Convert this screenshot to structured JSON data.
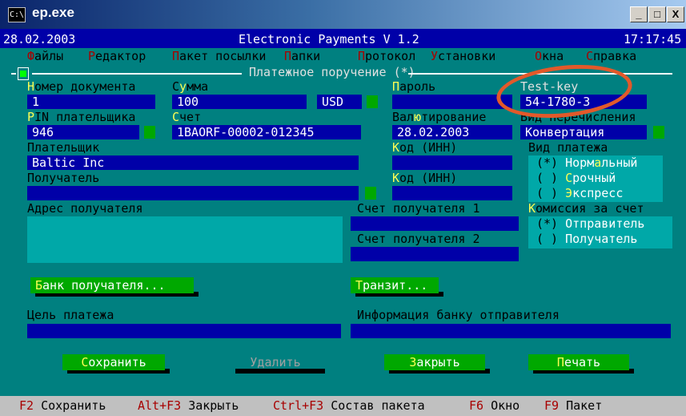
{
  "window": {
    "title": "ep.exe",
    "icon_text": "C:\\",
    "buttons": {
      "minimize": "_",
      "maximize": "□",
      "close": "X"
    }
  },
  "status": {
    "date": "28.02.2003",
    "app_title": "Electronic Payments V 1.2",
    "time": "17:17:45"
  },
  "menu": [
    {
      "hk": "Ф",
      "rest": "айлы"
    },
    {
      "hk": "Р",
      "rest": "едактор"
    },
    {
      "hk": "П",
      "rest": "акет посылки"
    },
    {
      "hk": "П",
      "rest": "апки"
    },
    {
      "hk": "П",
      "rest": "ротокол"
    },
    {
      "hk": "У",
      "rest": "становки"
    },
    {
      "hk": "О",
      "rest": "кна"
    },
    {
      "hk": "С",
      "rest": "правка"
    }
  ],
  "form": {
    "title": "Платежное поручение (*)",
    "doc_number": {
      "hk": "Н",
      "label": "омер документа",
      "value": "1"
    },
    "amount": {
      "hk": "у",
      "pre": "С",
      "label": "мма",
      "value": "100",
      "currency": "USD"
    },
    "password": {
      "hk": "П",
      "label": "ароль",
      "value": ""
    },
    "test_key": {
      "label": "Test-key",
      "value": "54-1780-3"
    },
    "pin": {
      "hk": "P",
      "label": "IN плательщика",
      "value": "946"
    },
    "account": {
      "hk": "С",
      "label": "чет",
      "value": "1BAORF-00002-012345"
    },
    "valuation": {
      "pre": "Вал",
      "hk": "ю",
      "label": "тирование",
      "value": "28.02.2003"
    },
    "transfer_type": {
      "label": "Вид перечисления",
      "value": "Конвертация"
    },
    "payer": {
      "label": "Плательщик",
      "value": "Baltic Inc"
    },
    "payer_inn": {
      "hk": "К",
      "label": "од (ИНН)",
      "value": ""
    },
    "payment_type": {
      "label": "Вид платежа",
      "options": [
        {
          "mark": "(*)",
          "pre": "Норм",
          "hk": "а",
          "rest": "льный"
        },
        {
          "mark": "( )",
          "pre": "",
          "hk": "С",
          "rest": "рочный"
        },
        {
          "mark": "( )",
          "pre": "",
          "hk": "Э",
          "rest": "кспресс"
        }
      ]
    },
    "recipient": {
      "label": "Получатель",
      "value": ""
    },
    "recipient_inn": {
      "hk": "К",
      "label": "од (ИНН)",
      "value": ""
    },
    "recipient_address": {
      "label": "Адрес получателя",
      "value": ""
    },
    "recipient_account1": {
      "label": "Счет получателя 1",
      "value": ""
    },
    "recipient_account2": {
      "label": "Счет получателя 2",
      "value": ""
    },
    "commission": {
      "hk": "К",
      "label": "омиссия за счет",
      "options": [
        {
          "mark": "(*)",
          "label": "Отправитель"
        },
        {
          "mark": "( )",
          "label": "Получатель"
        }
      ]
    },
    "bank_button": {
      "hk": "Б",
      "rest": "анк получателя..."
    },
    "transit_button": {
      "hk": "Т",
      "rest": "ранзит..."
    },
    "purpose": {
      "label": "Цель платежа",
      "value": ""
    },
    "bank_info": {
      "label": "Информация банку отправителя",
      "value": ""
    },
    "actions": {
      "save": {
        "hk": "С",
        "rest": "охранить"
      },
      "delete": "Удалить",
      "close": {
        "hk": "З",
        "rest": "акрыть"
      },
      "print": {
        "hk": "П",
        "rest": "ечать"
      }
    }
  },
  "fkeys": [
    {
      "key": "F2",
      "label": "Сохранить"
    },
    {
      "key": "Alt+F3",
      "label": "Закрыть"
    },
    {
      "key": "Ctrl+F3",
      "label": "Состав пакета"
    },
    {
      "key": "F6",
      "label": "Окно"
    },
    {
      "key": "F9",
      "label": "Пакет"
    }
  ],
  "colors": {
    "console_bg": "#0000a8",
    "form_bg": "#008080",
    "accent_green": "#00a800",
    "annotation": "#e2592a"
  }
}
